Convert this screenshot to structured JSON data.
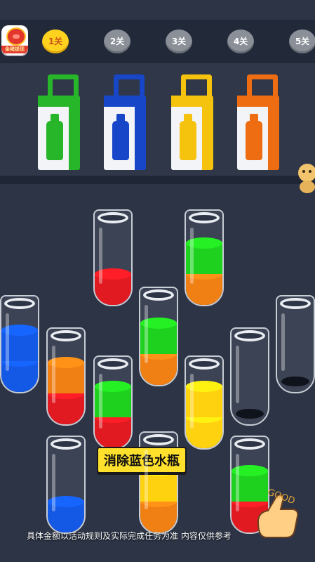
{
  "header": {
    "logo_caption": "金猪提现",
    "levels": [
      {
        "label": "1关",
        "active": true
      },
      {
        "label": "2关",
        "active": false
      },
      {
        "label": "3关",
        "active": false
      },
      {
        "label": "4关",
        "active": false
      },
      {
        "label": "5关",
        "active": false
      }
    ]
  },
  "bags": [
    {
      "color": "green",
      "hex": "#27b52a"
    },
    {
      "color": "blue",
      "hex": "#1846c8"
    },
    {
      "color": "yellow",
      "hex": "#f5c20d"
    },
    {
      "color": "orange",
      "hex": "#ee6d12"
    }
  ],
  "palette": {
    "red": "#e11a22",
    "green": "#1fd11f",
    "blue": "#1458e6",
    "orange": "#f07f14",
    "yellow": "#ffd20f"
  },
  "tubes": [
    {
      "id": "a",
      "layers": [
        "red"
      ]
    },
    {
      "id": "b",
      "layers": [
        "orange",
        "green"
      ]
    },
    {
      "id": "c",
      "layers": [
        "blue",
        "blue"
      ]
    },
    {
      "id": "d",
      "layers": [
        "orange",
        "green"
      ]
    },
    {
      "id": "e",
      "layers": []
    },
    {
      "id": "f",
      "layers": []
    },
    {
      "id": "g",
      "layers": [
        "red",
        "orange"
      ]
    },
    {
      "id": "h",
      "layers": [
        "red",
        "green"
      ]
    },
    {
      "id": "i",
      "layers": [
        "yellow",
        "yellow"
      ]
    },
    {
      "id": "j",
      "layers": [
        "blue"
      ]
    },
    {
      "id": "k",
      "layers": [
        "orange",
        "yellow"
      ]
    },
    {
      "id": "l",
      "layers": [
        "red",
        "green"
      ]
    }
  ],
  "overlay": {
    "hint_text": "消除蓝色水瓶",
    "disclaimer": "具体金额以活动规则及实际完成任务为准 内容仅供参考",
    "thumb_text": "GOOD"
  }
}
